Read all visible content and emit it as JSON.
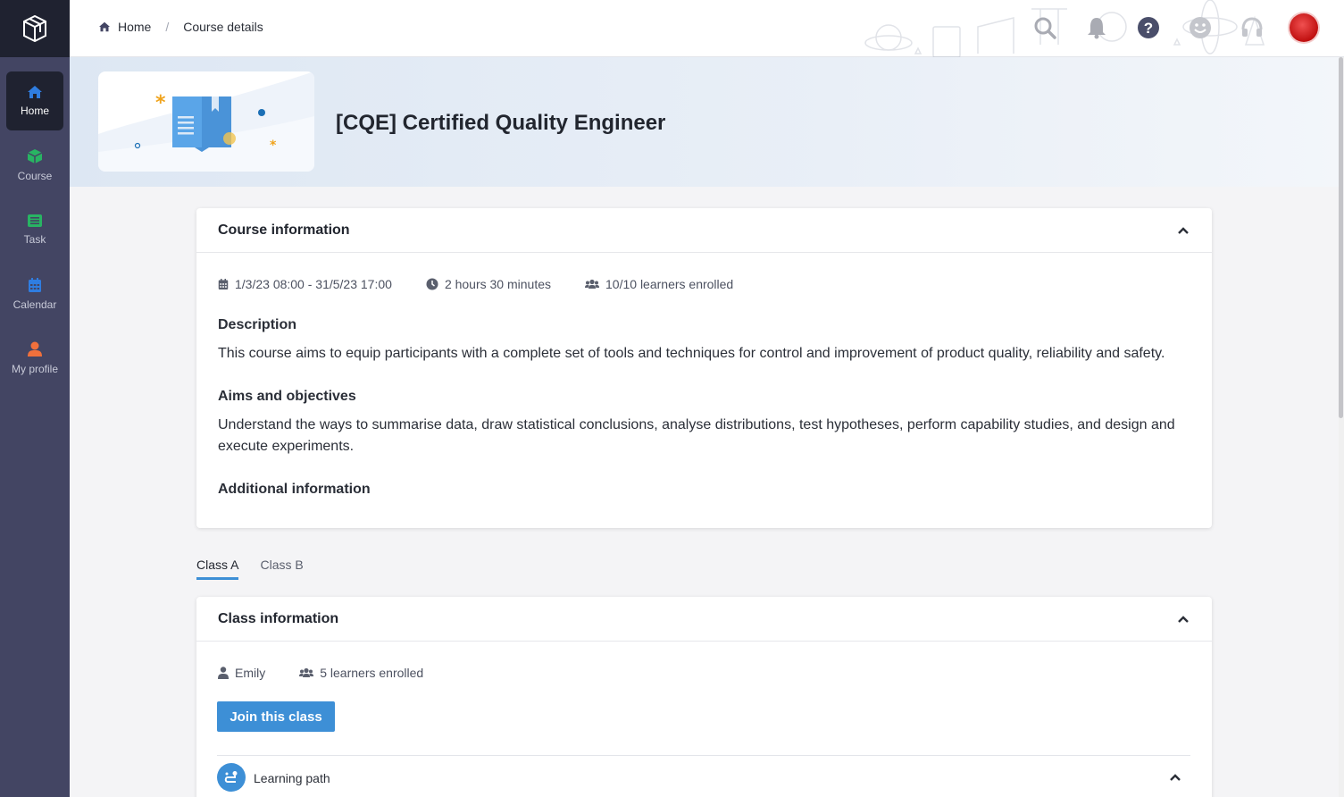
{
  "sidebar": {
    "items": [
      {
        "label": "Home",
        "icon": "home-icon",
        "color": "#2f7de1"
      },
      {
        "label": "Course",
        "icon": "cube-icon",
        "color": "#28b463"
      },
      {
        "label": "Task",
        "icon": "task-icon",
        "color": "#28b463"
      },
      {
        "label": "Calendar",
        "icon": "calendar-icon",
        "color": "#2f7de1"
      },
      {
        "label": "My profile",
        "icon": "user-icon",
        "color": "#f0703c"
      }
    ]
  },
  "breadcrumb": {
    "home": "Home",
    "separator": "/",
    "current": "Course details"
  },
  "header": {
    "icons": [
      "search-icon",
      "bell-icon",
      "help-icon",
      "smiley-icon",
      "headset-icon",
      "avatar"
    ]
  },
  "course": {
    "title": "[CQE] Certified Quality Engineer"
  },
  "course_info": {
    "title": "Course information",
    "dates": "1/3/23 08:00 - 31/5/23 17:00",
    "duration": "2 hours 30 minutes",
    "enrolled": "10/10 learners enrolled",
    "description_title": "Description",
    "description": "This course aims to equip participants with a complete set of tools and techniques for control and improvement of product quality, reliability and safety.",
    "aims_title": "Aims and objectives",
    "aims": "Understand the ways to summarise data, draw statistical conclusions, analyse distributions, test hypotheses, perform capability studies, and design and execute experiments.",
    "additional_title": "Additional information"
  },
  "tabs": [
    {
      "label": "Class A",
      "active": true
    },
    {
      "label": "Class B",
      "active": false
    }
  ],
  "class_info": {
    "title": "Class information",
    "instructor": "Emily",
    "enrolled": "5 learners enrolled",
    "join_label": "Join this class",
    "learning_path_label": "Learning path"
  },
  "colors": {
    "accent": "#3d8fd6",
    "sidebar": "#434563",
    "sidebar_dark": "#1f2230"
  }
}
